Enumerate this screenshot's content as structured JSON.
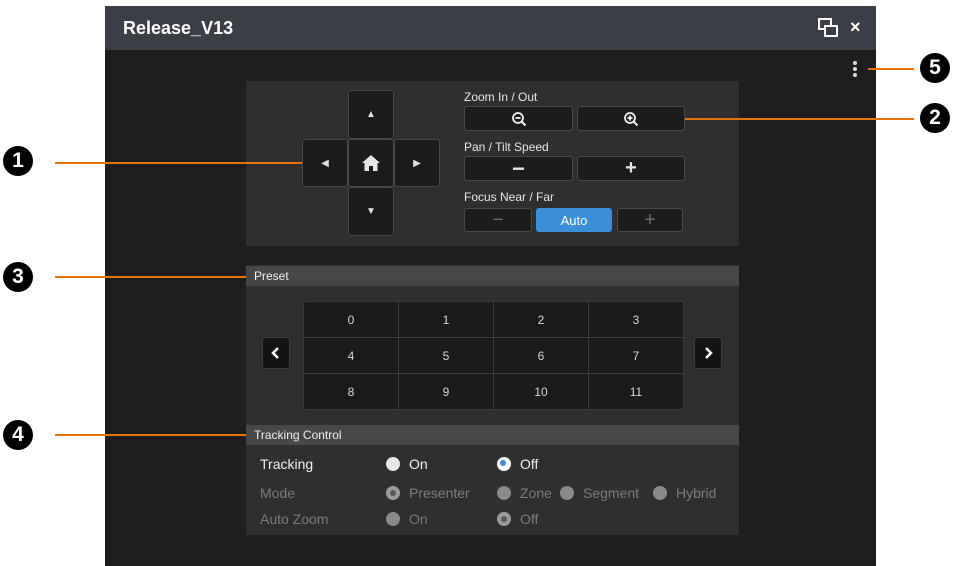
{
  "window": {
    "title": "Release_V13",
    "restore_icon": "restore-window-icon",
    "close_label": "×",
    "menu_icon": "more-vertical-icon"
  },
  "ptz": {
    "dpad": {
      "up": "▲",
      "down": "▼",
      "left": "◀",
      "right": "▶",
      "home_icon": "home-icon"
    },
    "zoom_label": "Zoom In / Out",
    "zoom_out_icon": "zoom-out-icon",
    "zoom_in_icon": "zoom-in-icon",
    "speed_label": "Pan / Tilt Speed",
    "speed_minus": "−",
    "speed_plus": "+",
    "focus_label": "Focus Near / Far",
    "focus_minus": "−",
    "focus_auto": "Auto",
    "focus_plus": "+",
    "accent": "#3a8fd6"
  },
  "preset": {
    "header": "Preset",
    "cells": [
      "0",
      "1",
      "2",
      "3",
      "4",
      "5",
      "6",
      "7",
      "8",
      "9",
      "10",
      "11"
    ],
    "prev_icon": "chevron-left-icon",
    "next_icon": "chevron-right-icon"
  },
  "tracking": {
    "header": "Tracking Control",
    "tracking_label": "Tracking",
    "tracking_on": "On",
    "tracking_off": "Off",
    "tracking_selected": "Off",
    "mode_label": "Mode",
    "modes": [
      "Presenter",
      "Zone",
      "Segment",
      "Hybrid"
    ],
    "mode_selected": "Presenter",
    "autozoom_label": "Auto Zoom",
    "autozoom_on": "On",
    "autozoom_off": "Off",
    "autozoom_selected": "Off"
  },
  "callouts": [
    "1",
    "2",
    "3",
    "4",
    "5"
  ],
  "callout_color": "#e8710a"
}
